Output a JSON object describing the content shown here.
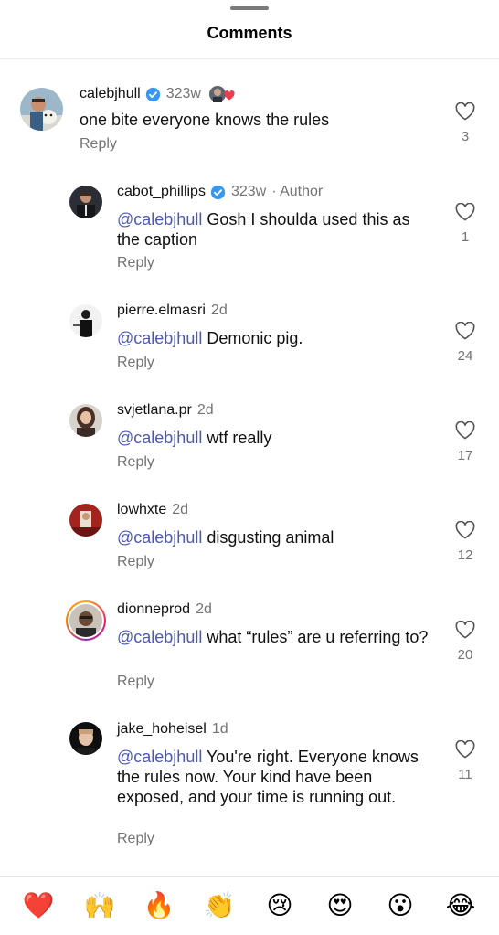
{
  "header": {
    "title": "Comments"
  },
  "comments": [
    {
      "username": "calebjhull",
      "verified": true,
      "time": "323w",
      "liked_by_author": true,
      "mention": "",
      "text": "one bite everyone knows the rules",
      "reply": "Reply",
      "likes": "3"
    },
    {
      "username": "cabot_phillips",
      "verified": true,
      "time": "323w",
      "author_tag": "· Author",
      "mention": "@calebjhull",
      "text": " Gosh I shoulda used this as the caption",
      "reply": "Reply",
      "likes": "1"
    },
    {
      "username": "pierre.elmasri",
      "verified": false,
      "time": "2d",
      "mention": "@calebjhull",
      "text": " Demonic pig.",
      "reply": "Reply",
      "likes": "24"
    },
    {
      "username": "svjetlana.pr",
      "verified": false,
      "time": "2d",
      "mention": "@calebjhull",
      "text": " wtf really",
      "reply": "Reply",
      "likes": "17"
    },
    {
      "username": "lowhxte",
      "verified": false,
      "time": "2d",
      "mention": "@calebjhull",
      "text": " disgusting animal",
      "reply": "Reply",
      "likes": "12"
    },
    {
      "username": "dionneprod",
      "verified": false,
      "time": "2d",
      "mention": "@calebjhull",
      "text": " what “rules” are u referring to?",
      "reply": "Reply",
      "likes": "20"
    },
    {
      "username": "jake_hoheisel",
      "verified": false,
      "time": "1d",
      "mention": "@calebjhull",
      "text": " You're right. Everyone knows the rules now. Your kind have been exposed, and your time is running out.",
      "reply": "Reply",
      "likes": "11"
    }
  ],
  "emoji_bar": [
    "❤️",
    "🙌",
    "🔥",
    "👏",
    "😢",
    "😍",
    "😮",
    "😂"
  ],
  "colors": {
    "mention": "#4a58b8",
    "secondary": "#737373",
    "verified": "#3897f0"
  }
}
